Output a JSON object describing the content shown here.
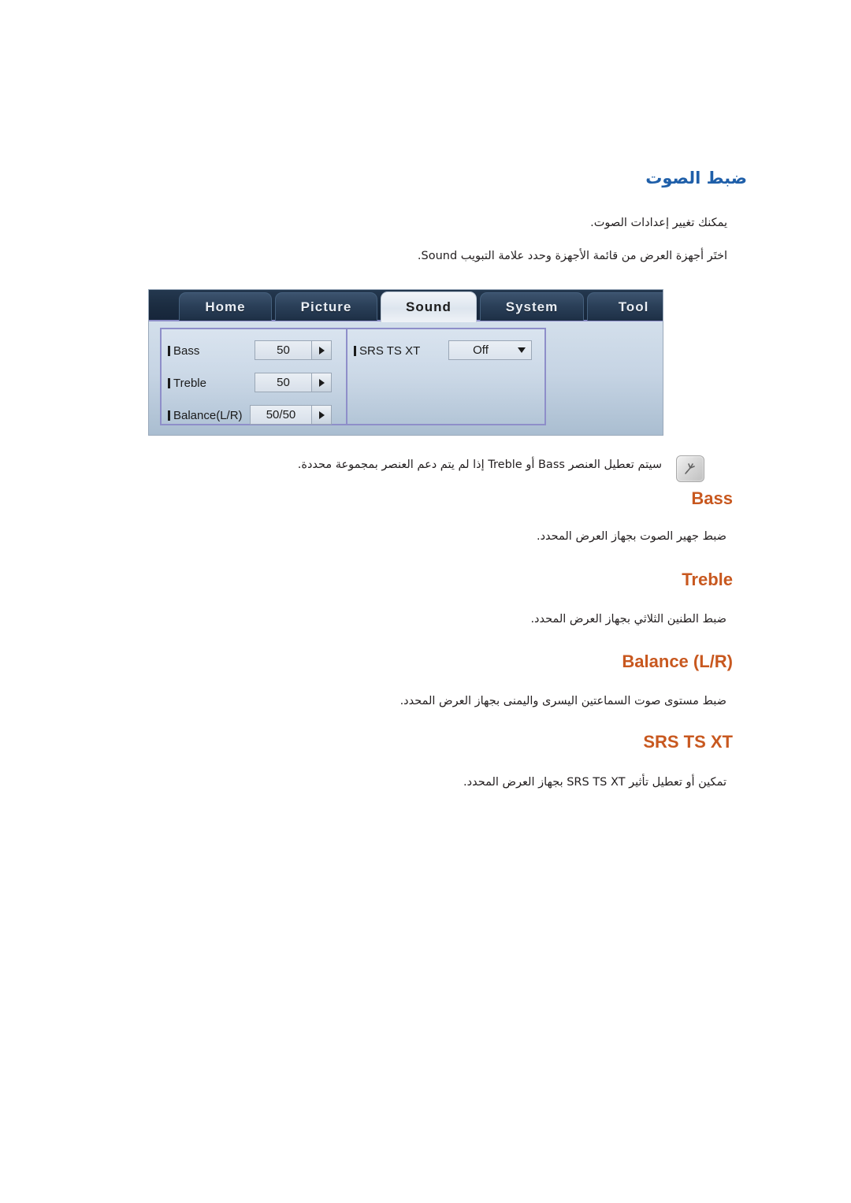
{
  "page": {
    "title_ar": "ضبط الصوت",
    "intro_line_1": "يمكنك تغيير إعدادات الصوت.",
    "intro_line_2": "اختَر أجهزة العرض من قائمة الأجهزة وحدد علامة التبويب Sound.",
    "note_text": "سيتم تعطيل العنصر Bass أو Treble إذا لم يتم دعم العنصر بمجموعة محددة.",
    "note_icon": "note-pen-icon",
    "heading_color": "#c8581f",
    "title_color": "#1f5fa9",
    "body_text_color": "#231f20"
  },
  "osd": {
    "tabs": [
      {
        "label": "Home",
        "active": false
      },
      {
        "label": "Picture",
        "active": false
      },
      {
        "label": "Sound",
        "active": true
      },
      {
        "label": "System",
        "active": false
      },
      {
        "label": "Tool",
        "active": false
      }
    ],
    "left_panel": {
      "rows": [
        {
          "label": "Bass",
          "value": "50",
          "control": "arrow-right-stepper"
        },
        {
          "label": "Treble",
          "value": "50",
          "control": "arrow-right-stepper"
        },
        {
          "label": "Balance(L/R)",
          "value": "50/50",
          "control": "arrow-right-stepper"
        }
      ]
    },
    "right_panel": {
      "rows": [
        {
          "label": "SRS TS XT",
          "value": "Off",
          "control": "dropdown"
        }
      ]
    },
    "highlight_border_color": "#8e8ec9",
    "tabbar_color": "#1b2c40"
  },
  "sections": [
    {
      "heading": "Bass",
      "body": "ضبط جهير الصوت بجهاز العرض المحدد."
    },
    {
      "heading": "Treble",
      "body": "ضبط الطنين الثلاثي بجهاز العرض المحدد."
    },
    {
      "heading": "Balance (L/R)",
      "body": "ضبط مستوى صوت السماعتين اليسرى واليمنى بجهاز العرض المحدد."
    },
    {
      "heading": "SRS TS XT",
      "body": "تمكين أو تعطيل تأثير SRS TS XT بجهاز العرض المحدد."
    }
  ]
}
